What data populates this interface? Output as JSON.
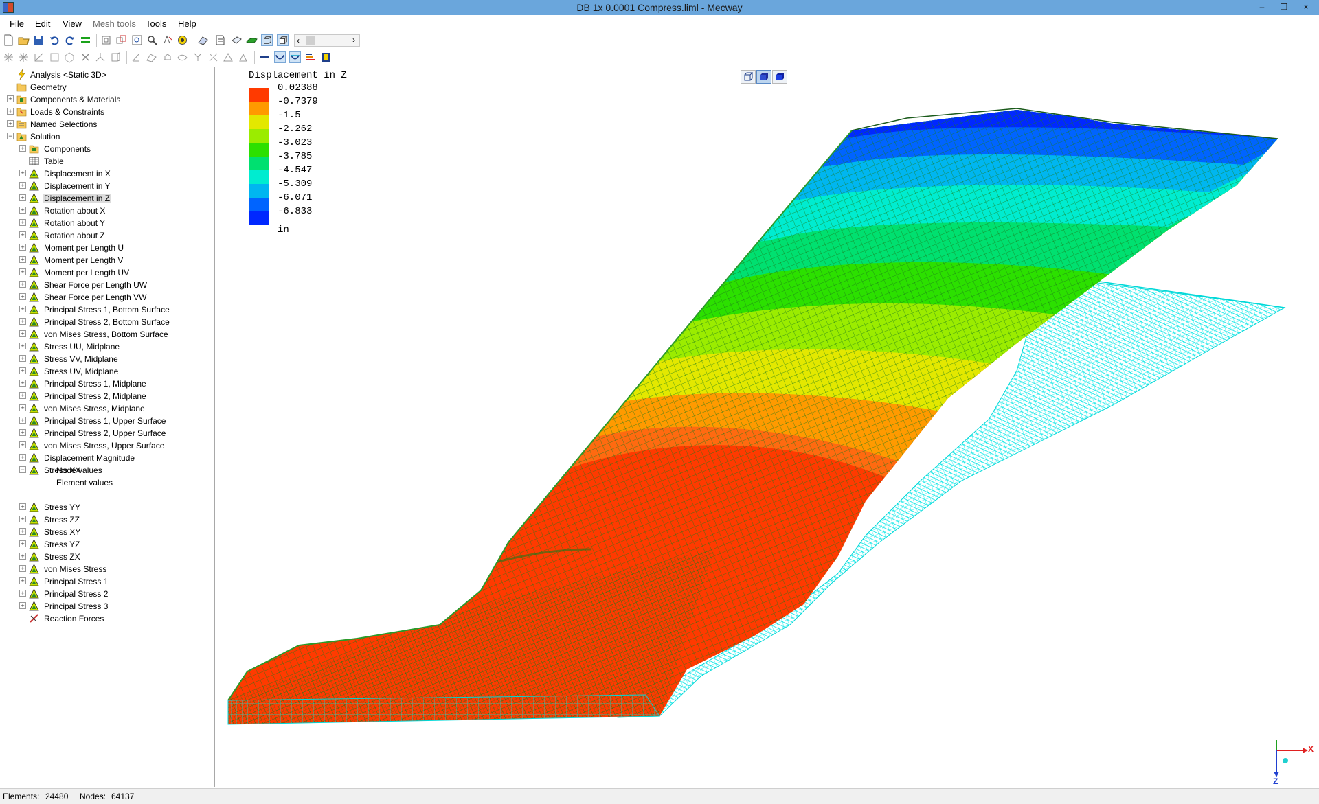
{
  "window": {
    "title": "DB 1x 0.0001 Compress.liml - Mecway",
    "minimize": "–",
    "restore": "❐",
    "close": "×"
  },
  "menu": {
    "file": "File",
    "edit": "Edit",
    "view": "View",
    "mesh_tools": "Mesh tools",
    "tools": "Tools",
    "help": "Help"
  },
  "tree": {
    "analysis": "Analysis <Static 3D>",
    "geometry": "Geometry",
    "components_materials": "Components & Materials",
    "loads_constraints": "Loads & Constraints",
    "named_selections": "Named Selections",
    "solution": "Solution",
    "components": "Components",
    "table": "Table",
    "items": [
      "Displacement in X",
      "Displacement in Y",
      "Displacement in Z",
      "Rotation about X",
      "Rotation about Y",
      "Rotation about Z",
      "Moment per Length U",
      "Moment per Length V",
      "Moment per Length UV",
      "Shear Force per Length UW",
      "Shear Force per Length VW",
      "Principal Stress 1, Bottom Surface",
      "Principal Stress 2, Bottom Surface",
      "von Mises Stress, Bottom Surface",
      "Stress UU, Midplane",
      "Stress VV, Midplane",
      "Stress UV, Midplane",
      "Principal Stress 1, Midplane",
      "Principal Stress 2, Midplane",
      "von Mises Stress, Midplane",
      "Principal Stress 1, Upper Surface",
      "Principal Stress 2, Upper Surface",
      "von Mises Stress, Upper Surface",
      "Displacement Magnitude",
      "Stress XX"
    ],
    "node_values": "Node values",
    "element_values": "Element values",
    "items2": [
      "Stress YY",
      "Stress ZZ",
      "Stress XY",
      "Stress YZ",
      "Stress ZX",
      "von Mises Stress",
      "Principal Stress 1",
      "Principal Stress 2",
      "Principal Stress 3"
    ],
    "reaction_forces": "Reaction Forces"
  },
  "legend": {
    "title": "Displacement in Z",
    "values": [
      "0.02388",
      "-0.7379",
      "-1.5",
      "-2.262",
      "-3.023",
      "-3.785",
      "-4.547",
      "-5.309",
      "-6.071",
      "-6.833"
    ],
    "colors": [
      "#ff3a00",
      "#ff9a00",
      "#e3e800",
      "#9bec00",
      "#2ce000",
      "#00e070",
      "#00ecd0",
      "#00b6f0",
      "#0064ff",
      "#0028ff"
    ],
    "unit": "in"
  },
  "triad": {
    "x": "X",
    "z": "Z"
  },
  "status": {
    "elements_label": "Elements:",
    "elements_value": "24480",
    "nodes_label": "Nodes:",
    "nodes_value": "64137"
  },
  "icons": {
    "toolbar1": [
      "new-icon",
      "open-icon",
      "save-icon",
      "undo-icon",
      "redo-icon",
      "separator-icon",
      "select-nodes-icon",
      "select-elements-icon",
      "zoom-fit-icon",
      "zoom-icon",
      "pan-icon",
      "rotate-icon",
      "solve-icon",
      "mesh-icon",
      "sheet-icon",
      "shell-icon",
      "wireframe-icon",
      "solid-icon"
    ],
    "toolbar2": [
      "node-icon",
      "element-icon",
      "line-icon",
      "box-icon",
      "sphere-icon",
      "delete-icon",
      "merge-icon",
      "extrude-icon",
      "refine-icon",
      "measure-icon",
      "mirror-icon",
      "split-icon",
      "rotate-mesh-icon",
      "scale-icon",
      "triangle-icon",
      "line-weight-icon",
      "deformed-icon",
      "undeformed-icon",
      "contour-icon",
      "film-icon"
    ]
  }
}
